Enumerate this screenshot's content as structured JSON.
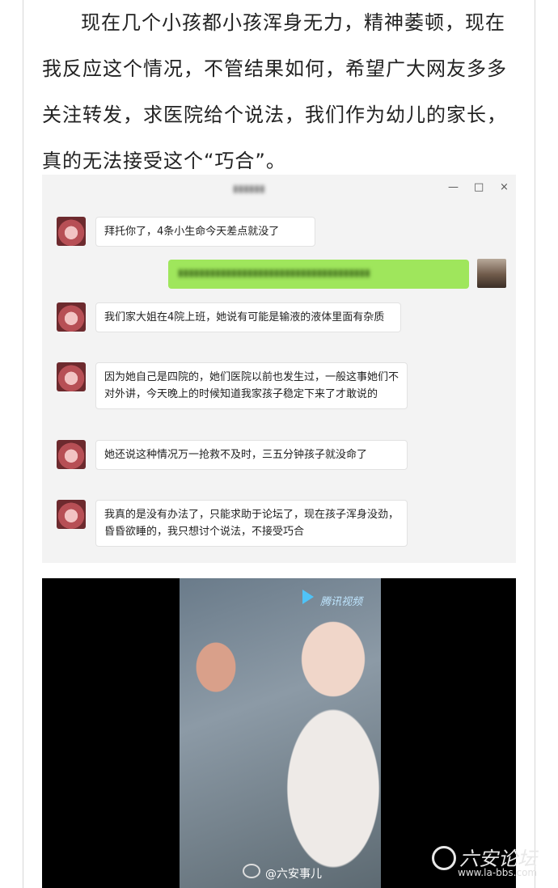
{
  "article": {
    "paragraph": "现在几个小孩都小孩浑身无力，精神萎顿，现在我反应这个情况，不管结果如何，希望广大网友多多关注转发，求医院给个说法，我们作为幼儿的家长，真的无法接受这个“巧合”。"
  },
  "chat": {
    "window_controls": {
      "minimize": "—",
      "maximize": "□",
      "close": "×"
    },
    "messages": [
      {
        "sender": "other",
        "text": "拜托你了，4条小生命今天差点就没了"
      },
      {
        "sender": "other",
        "text": "我们家大姐在4院上班，她说有可能是输液的液体里面有杂质"
      },
      {
        "sender": "other",
        "text": "因为她自己是四院的，她们医院以前也发生过，一般这事她们不对外讲，今天晚上的时候知道我家孩子稳定下来了才敢说的"
      },
      {
        "sender": "other",
        "text": "她还说这种情况万一抢救不及时，三五分钟孩子就没命了"
      },
      {
        "sender": "other",
        "text": "我真的是没有办法了，只能求助于论坛了，现在孩子浑身没劲，昏昏欲睡的，我只想讨个说法，不接受巧合"
      }
    ]
  },
  "video": {
    "overlay_text": "腾讯视频"
  },
  "watermarks": {
    "weibo": "@六安事儿",
    "site_name": "六安论坛",
    "site_url": "www.la-bbs.com"
  }
}
